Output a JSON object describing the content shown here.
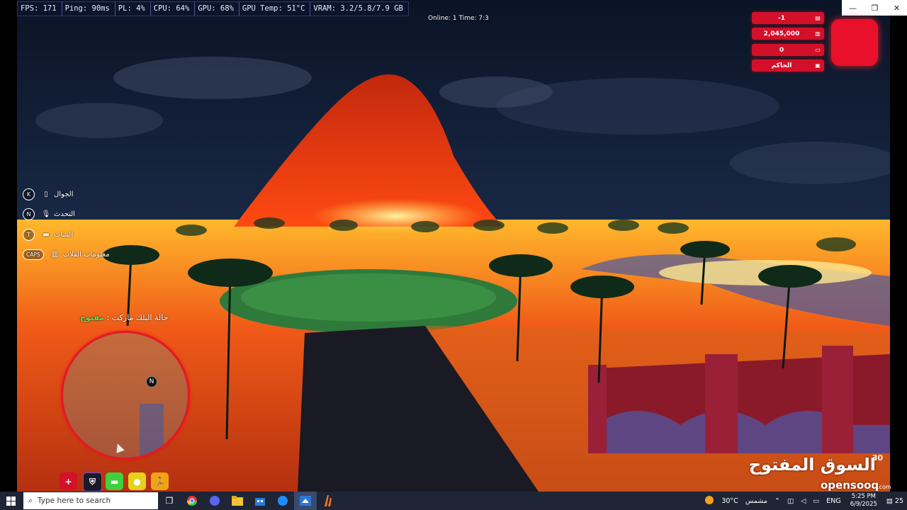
{
  "perf": [
    {
      "label": "FPS: 171"
    },
    {
      "label": "Ping: 90ms"
    },
    {
      "label": "PL: 4%"
    },
    {
      "label": "CPU: 64%"
    },
    {
      "label": "GPU: 68%"
    },
    {
      "label": "GPU Temp: 51°C"
    },
    {
      "label": "VRAM: 3.2/5.8/7.9 GB"
    }
  ],
  "status_line": "Online: 1 Time: 7:3",
  "window_controls": {
    "minimize": "—",
    "maximize": "❐",
    "close": "✕"
  },
  "stats": [
    {
      "value": "-1",
      "icon": "id-card-icon",
      "glyph": "▤"
    },
    {
      "value": "2,045,000",
      "icon": "bank-icon",
      "glyph": "▥"
    },
    {
      "value": "0",
      "icon": "wallet-icon",
      "glyph": "▭"
    },
    {
      "value": "الحاكم",
      "icon": "briefcase-icon",
      "glyph": "▣"
    }
  ],
  "hotkeys": [
    {
      "key": "K",
      "label": "الجوال",
      "icon": "phone-icon",
      "glyph": "▯"
    },
    {
      "key": "N",
      "label": "التحدث",
      "icon": "microphone-icon",
      "glyph": "🎙"
    },
    {
      "key": "T",
      "label": "الشات",
      "icon": "chat-icon",
      "glyph": "▬"
    },
    {
      "key": "CAPS",
      "label": "معلومات الفلات",
      "icon": "stats-icon",
      "glyph": "▥"
    }
  ],
  "bank_status": {
    "label": "حالة البلك ماركت :",
    "value": "مفتوح"
  },
  "minimap": {
    "north": "N"
  },
  "hud_buttons": [
    {
      "name": "health",
      "glyph": "+",
      "color": "#d4102a"
    },
    {
      "name": "armor",
      "glyph": "⛨",
      "color": "#1a1a2a"
    },
    {
      "name": "hunger",
      "glyph": "▬",
      "color": "#3fcf3f"
    },
    {
      "name": "thirst",
      "glyph": "●",
      "color": "#e6d21a"
    },
    {
      "name": "stamina",
      "glyph": "🏃",
      "color": "#f0a318"
    }
  ],
  "watermark": {
    "arabic": "السوق المفتوح",
    "number": "30",
    "latin": "opensooq",
    "domain": ".com"
  },
  "taskbar": {
    "search_placeholder": "Type here to search",
    "weather": "30°C",
    "weather_label": "مشمس",
    "language": "ENG",
    "time": "5:25 PM",
    "date": "6/9/2025",
    "notifications": "25"
  }
}
